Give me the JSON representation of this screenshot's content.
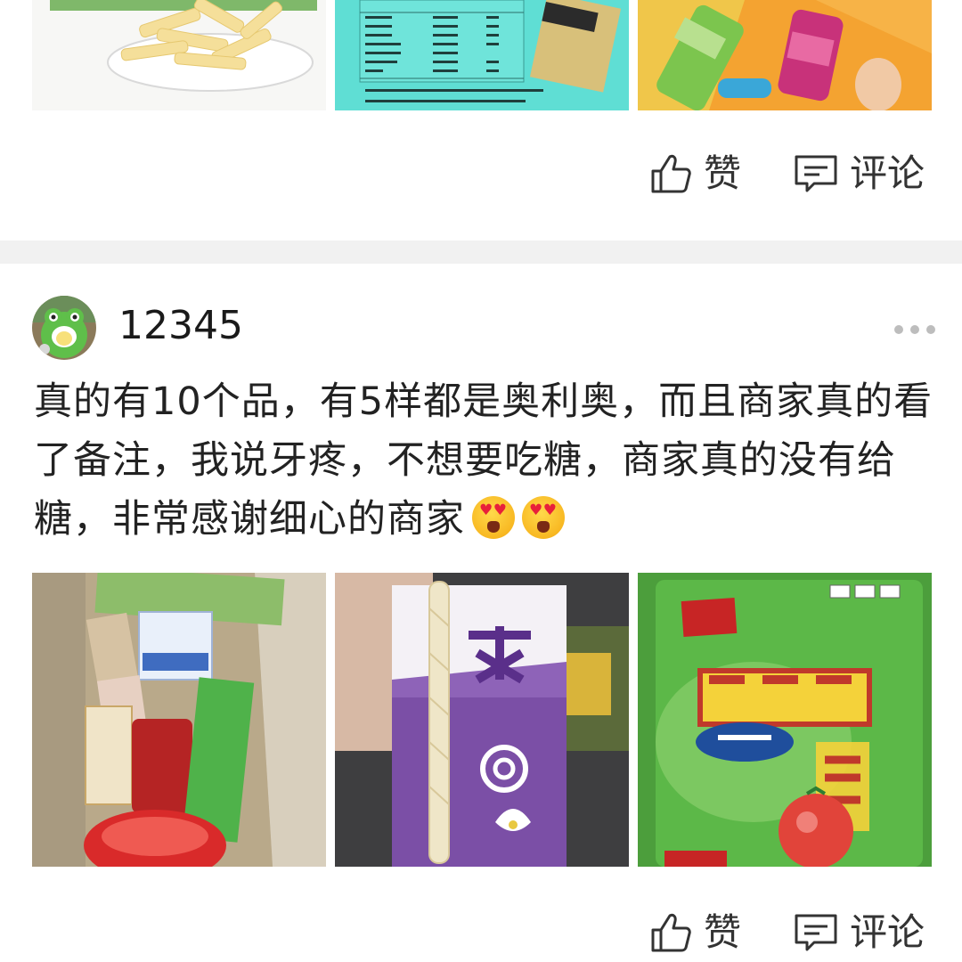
{
  "post1": {
    "actions": {
      "like_label": "赞",
      "comment_label": "评论"
    }
  },
  "post2": {
    "username": "12345",
    "text": "真的有10个品，有5样都是奥利奥，而且商家真的看了备注，我说牙疼，不想要吃糖，商家真的没有给糖，非常感谢细心的商家",
    "emoji_count": 2,
    "emoji_name": "heart-eyes-emoji",
    "actions": {
      "like_label": "赞",
      "comment_label": "评论"
    }
  },
  "icons": {
    "like": "thumbs-up-icon",
    "comment": "comment-bubble-icon",
    "more": "more-dots-icon"
  },
  "colors": {
    "divider": "#f1f1f1",
    "text": "#222222",
    "icon": "#333333"
  }
}
